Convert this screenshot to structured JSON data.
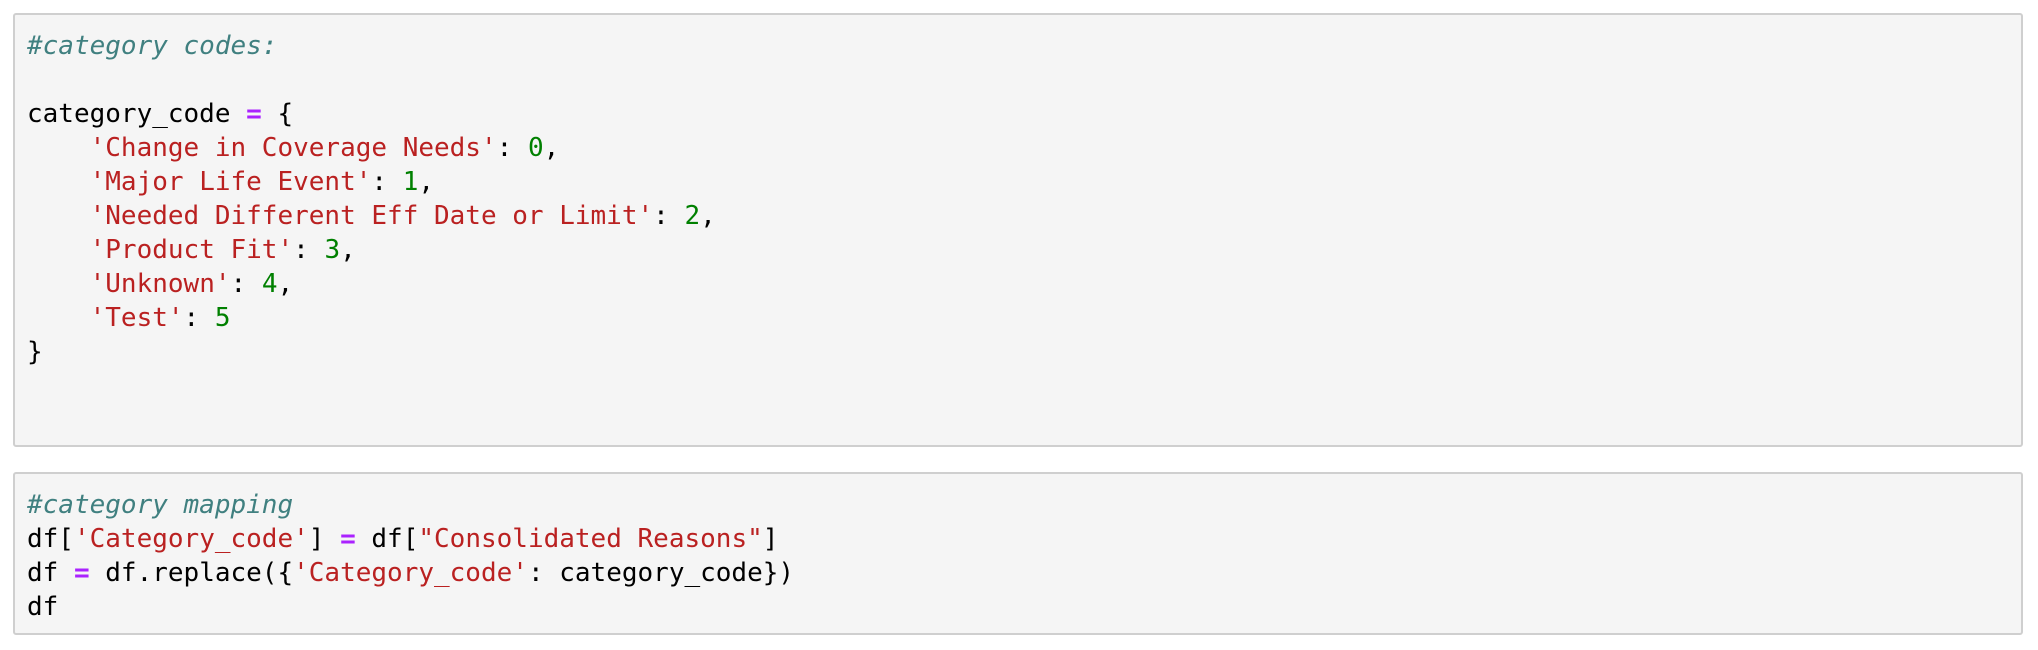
{
  "cells": [
    {
      "lines": [
        [
          {
            "t": "#category codes:",
            "k": "c"
          }
        ],
        [],
        [
          {
            "t": "category_code "
          },
          {
            "t": "=",
            "k": "o"
          },
          {
            "t": " {"
          }
        ],
        [
          {
            "t": "    "
          },
          {
            "t": "'Change in Coverage Needs'",
            "k": "s"
          },
          {
            "t": ": "
          },
          {
            "t": "0",
            "k": "n"
          },
          {
            "t": ","
          }
        ],
        [
          {
            "t": "    "
          },
          {
            "t": "'Major Life Event'",
            "k": "s"
          },
          {
            "t": ": "
          },
          {
            "t": "1",
            "k": "n"
          },
          {
            "t": ","
          }
        ],
        [
          {
            "t": "    "
          },
          {
            "t": "'Needed Different Eff Date or Limit'",
            "k": "s"
          },
          {
            "t": ": "
          },
          {
            "t": "2",
            "k": "n"
          },
          {
            "t": ","
          }
        ],
        [
          {
            "t": "    "
          },
          {
            "t": "'Product Fit'",
            "k": "s"
          },
          {
            "t": ": "
          },
          {
            "t": "3",
            "k": "n"
          },
          {
            "t": ","
          }
        ],
        [
          {
            "t": "    "
          },
          {
            "t": "'Unknown'",
            "k": "s"
          },
          {
            "t": ": "
          },
          {
            "t": "4",
            "k": "n"
          },
          {
            "t": ","
          }
        ],
        [
          {
            "t": "    "
          },
          {
            "t": "'Test'",
            "k": "s"
          },
          {
            "t": ": "
          },
          {
            "t": "5",
            "k": "n"
          }
        ],
        [
          {
            "t": "}"
          }
        ]
      ]
    },
    {
      "lines": [
        [
          {
            "t": "#category mapping",
            "k": "c"
          }
        ],
        [
          {
            "t": "df["
          },
          {
            "t": "'Category_code'",
            "k": "s"
          },
          {
            "t": "] "
          },
          {
            "t": "=",
            "k": "o"
          },
          {
            "t": " df["
          },
          {
            "t": "\"Consolidated Reasons\"",
            "k": "s"
          },
          {
            "t": "]"
          }
        ],
        [
          {
            "t": "df "
          },
          {
            "t": "=",
            "k": "o"
          },
          {
            "t": " df.replace({"
          },
          {
            "t": "'Category_code'",
            "k": "s"
          },
          {
            "t": ": category_code})"
          }
        ],
        [
          {
            "t": "df"
          }
        ]
      ]
    }
  ],
  "colors": {
    "cell_background": "#f5f5f5",
    "cell_border": "#cfcfcf",
    "comment": "#408080",
    "string": "#ba2121",
    "number": "#008000",
    "operator": "#aa22ff",
    "text": "#000000"
  }
}
